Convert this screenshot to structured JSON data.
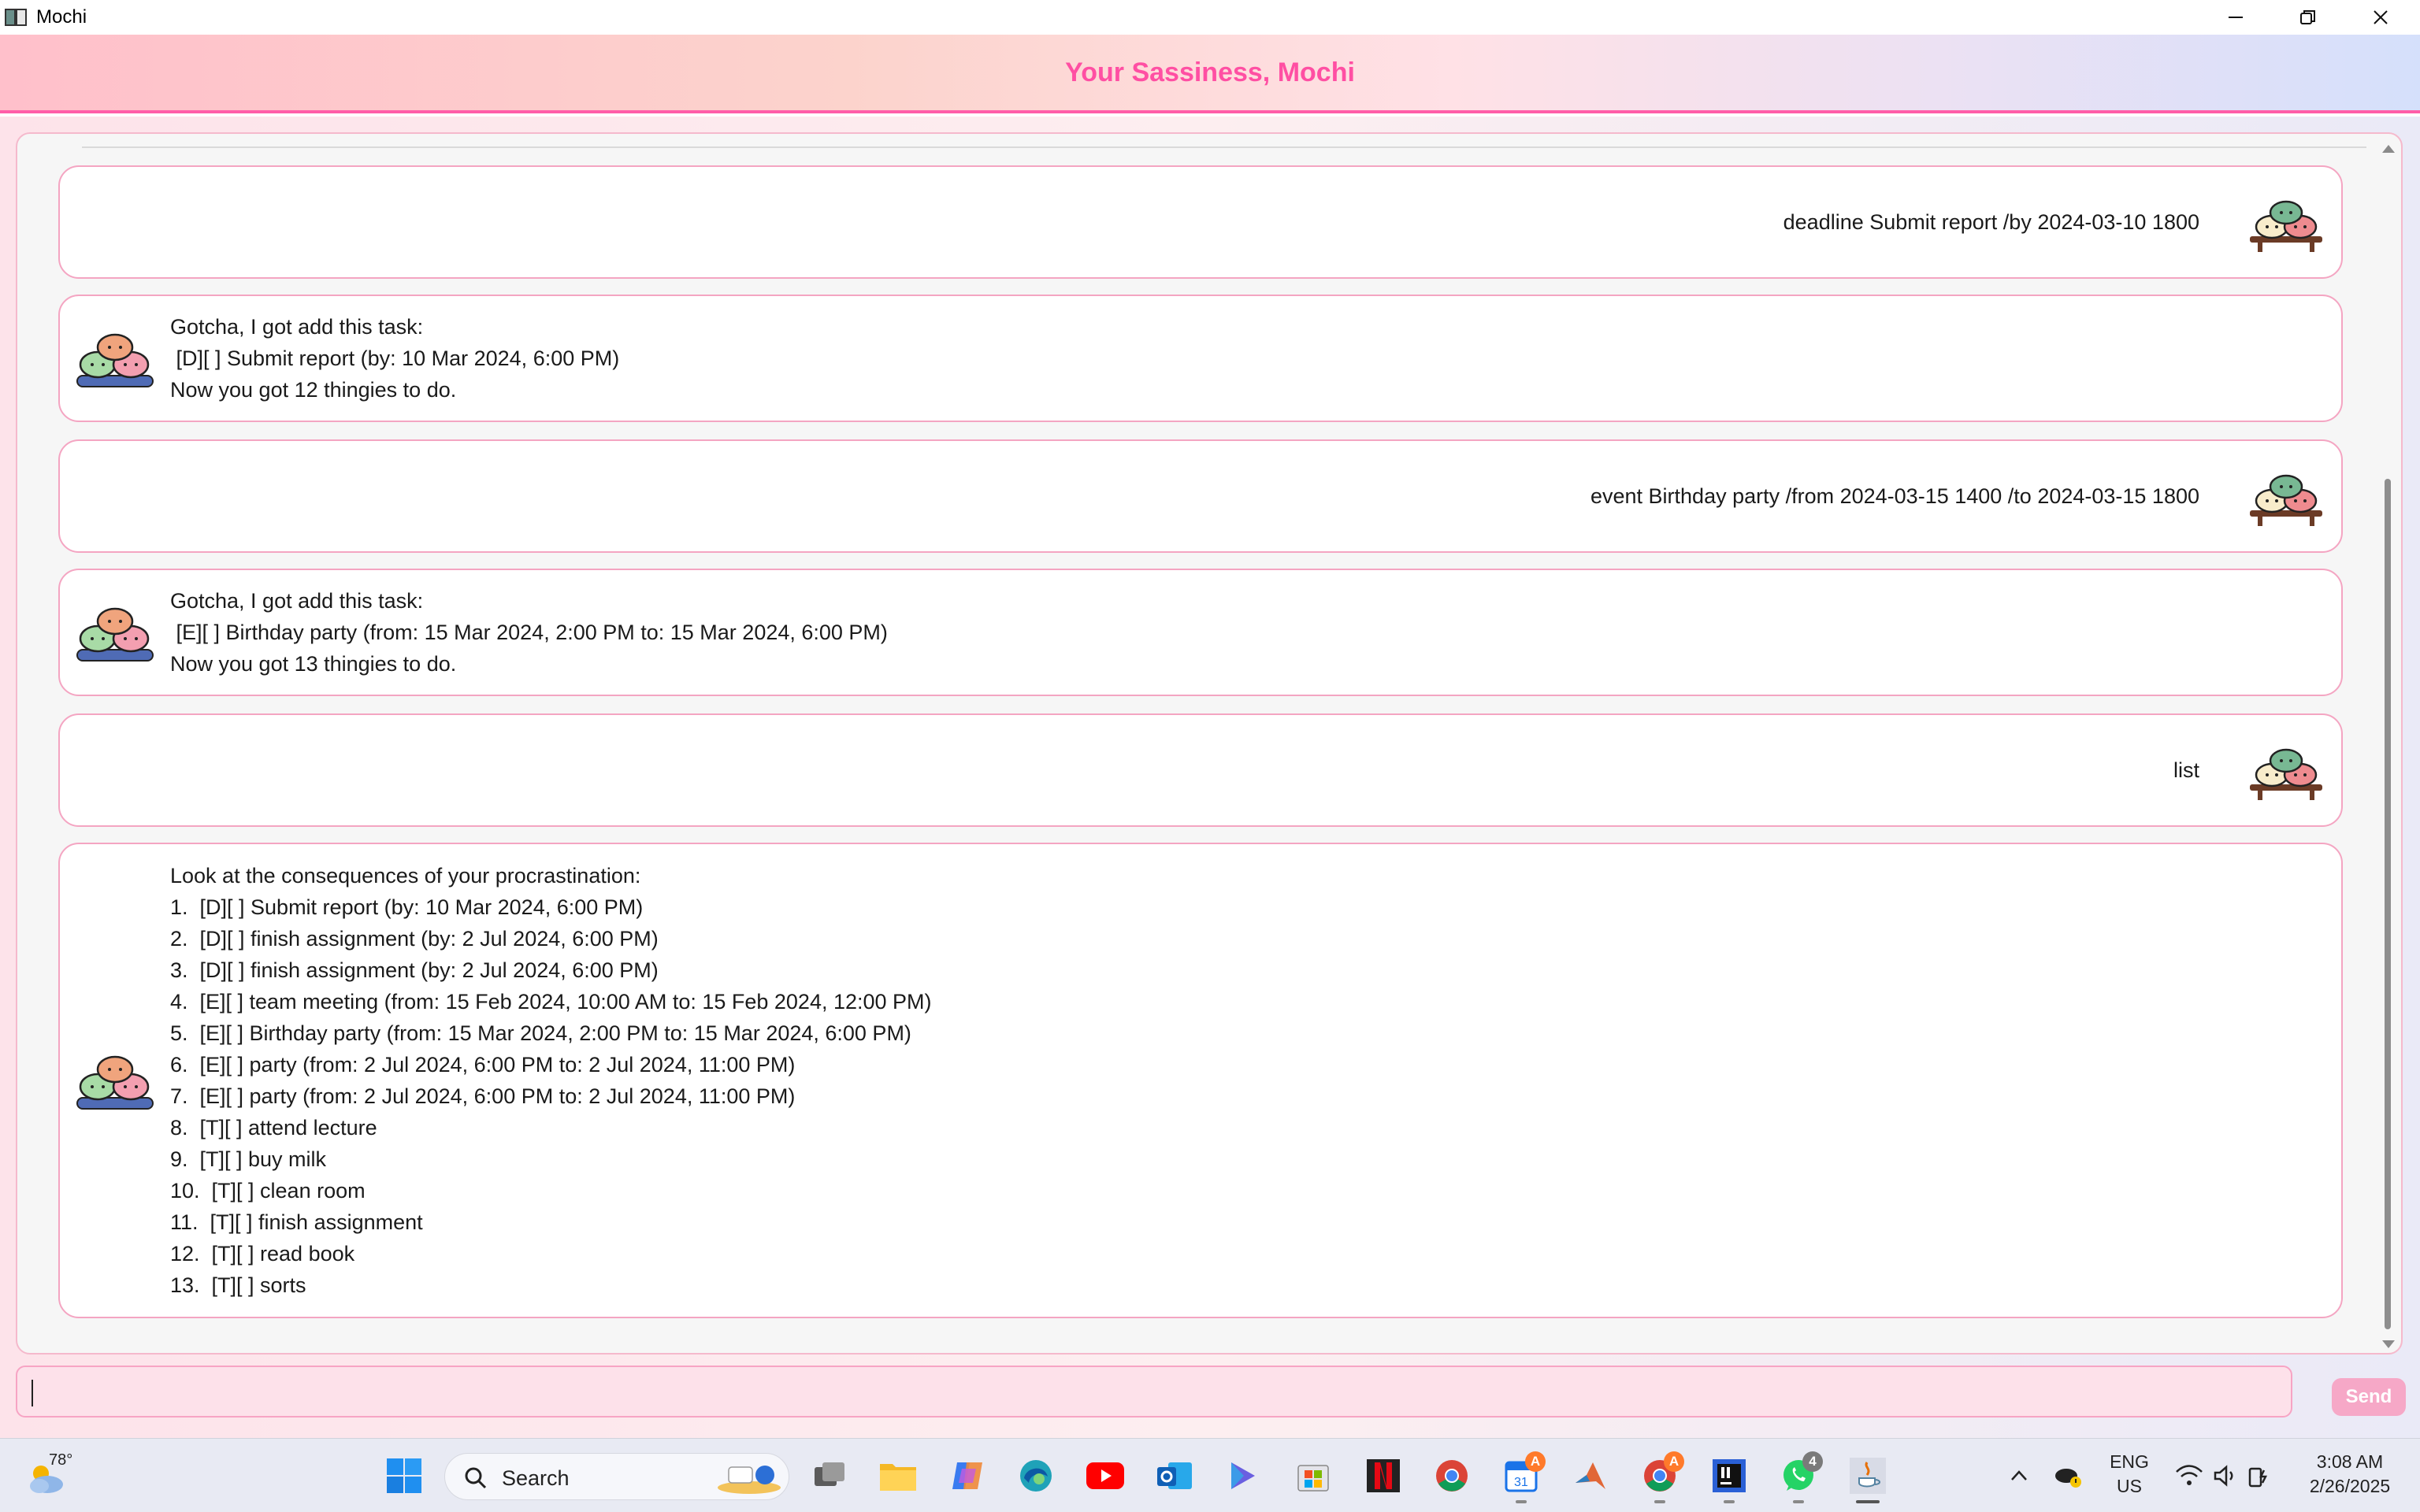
{
  "window": {
    "title": "Mochi",
    "controls": [
      "minimize-icon",
      "restore-icon",
      "close-icon"
    ]
  },
  "header": {
    "title": "Your Sassiness, Mochi"
  },
  "conversation": [
    {
      "from": "user",
      "text": "deadline Submit report /by 2024-03-10 1800"
    },
    {
      "from": "bot",
      "text": "Gotcha, I got add this task:\n [D][ ] Submit report (by: 10 Mar 2024, 6:00 PM)\nNow you got 12 thingies to do."
    },
    {
      "from": "user",
      "text": "event Birthday party /from 2024-03-15 1400 /to 2024-03-15 1800"
    },
    {
      "from": "bot",
      "text": "Gotcha, I got add this task:\n [E][ ] Birthday party (from: 15 Mar 2024, 2:00 PM to: 15 Mar 2024, 6:00 PM)\nNow you got 13 thingies to do."
    },
    {
      "from": "user",
      "text": "list"
    },
    {
      "from": "bot",
      "text": "Look at the consequences of your procrastination:\n1.  [D][ ] Submit report (by: 10 Mar 2024, 6:00 PM)\n2.  [D][ ] finish assignment (by: 2 Jul 2024, 6:00 PM)\n3.  [D][ ] finish assignment (by: 2 Jul 2024, 6:00 PM)\n4.  [E][ ] team meeting (from: 15 Feb 2024, 10:00 AM to: 15 Feb 2024, 12:00 PM)\n5.  [E][ ] Birthday party (from: 15 Mar 2024, 2:00 PM to: 15 Mar 2024, 6:00 PM)\n6.  [E][ ] party (from: 2 Jul 2024, 6:00 PM to: 2 Jul 2024, 11:00 PM)\n7.  [E][ ] party (from: 2 Jul 2024, 6:00 PM to: 2 Jul 2024, 11:00 PM)\n8.  [T][ ] attend lecture\n9.  [T][ ] buy milk\n10.  [T][ ] clean room\n11.  [T][ ] finish assignment\n12.  [T][ ] read book\n13.  [T][ ] sorts"
    }
  ],
  "input": {
    "value": "",
    "send_label": "Send"
  },
  "taskbar": {
    "weather_temp": "78°",
    "search_label": "Search",
    "apps": [
      {
        "name": "start-icon"
      },
      {
        "name": "task-view-icon"
      },
      {
        "name": "file-explorer-icon"
      },
      {
        "name": "copilot-icon"
      },
      {
        "name": "edge-icon"
      },
      {
        "name": "youtube-icon"
      },
      {
        "name": "outlook-icon"
      },
      {
        "name": "power-automate-icon"
      },
      {
        "name": "microsoft-store-icon"
      },
      {
        "name": "netflix-icon"
      },
      {
        "name": "chrome-icon"
      },
      {
        "name": "calendar-icon",
        "badge": "A"
      },
      {
        "name": "matlab-icon"
      },
      {
        "name": "chrome-profile-icon",
        "badge": "A"
      },
      {
        "name": "intellij-icon"
      },
      {
        "name": "whatsapp-icon",
        "badge": "4"
      },
      {
        "name": "java-icon"
      }
    ],
    "tray": {
      "lang_line1": "ENG",
      "lang_line2": "US",
      "time": "3:08 AM",
      "date": "2/26/2025"
    }
  },
  "colors": {
    "accent_pink": "#ff4fa3",
    "bubble_border": "#f4a5c2",
    "input_bg": "#fde1ea",
    "send_bg": "#f6a8c7"
  }
}
